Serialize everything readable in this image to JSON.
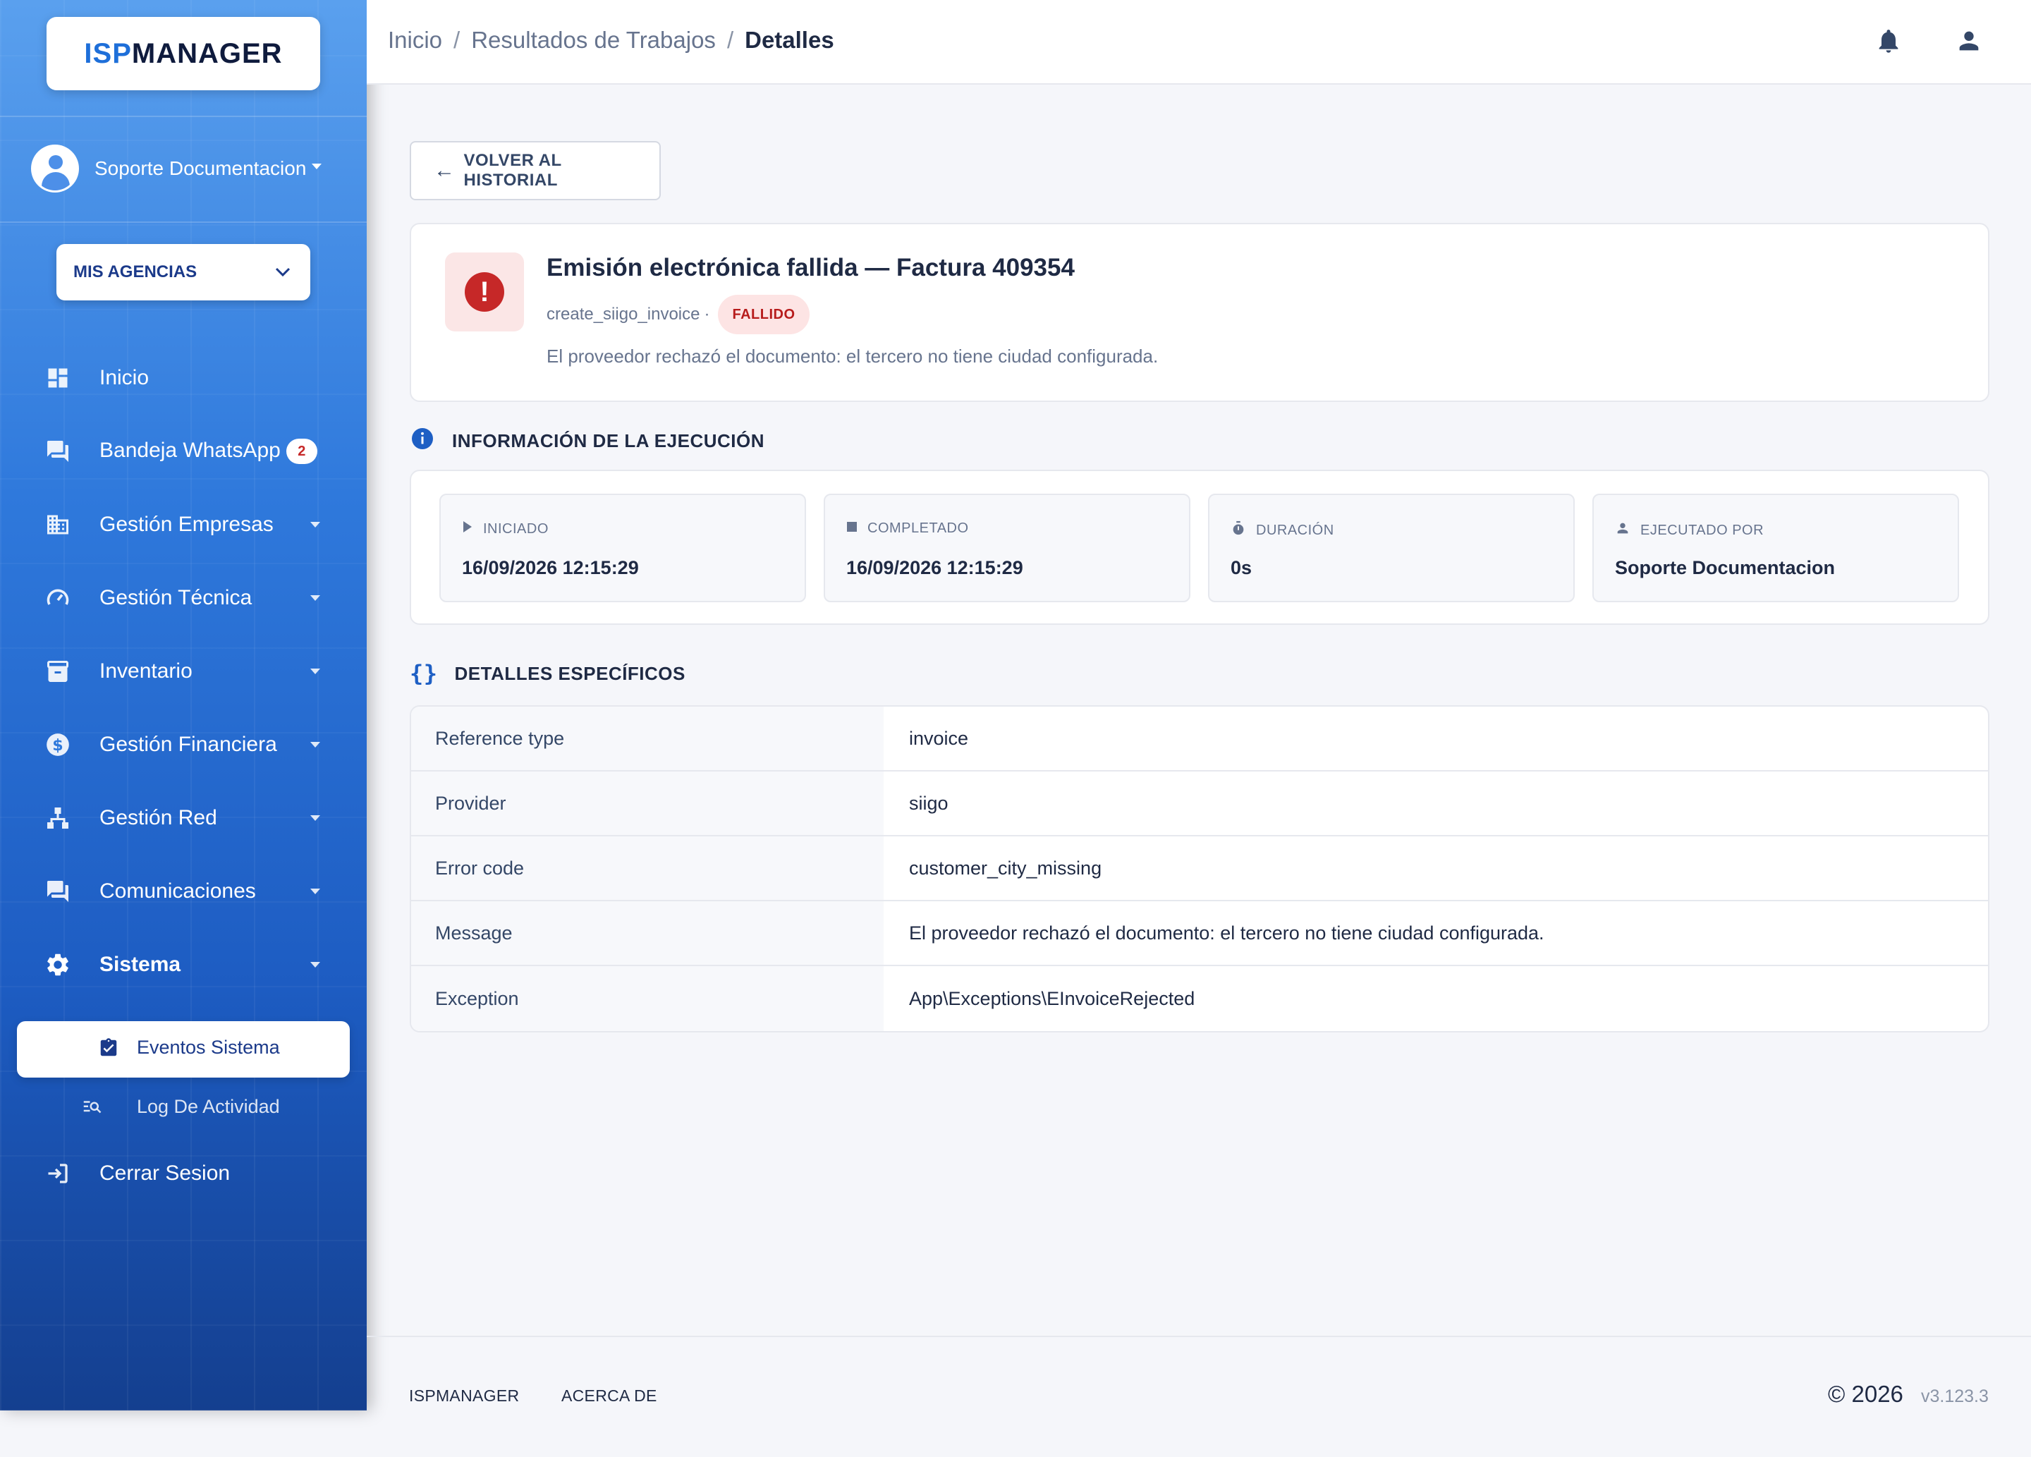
{
  "sidebar": {
    "logo": {
      "part1": "ISP",
      "part2": "MANAGER"
    },
    "user": {
      "name": "Soporte Documentacion"
    },
    "agency_button": "MIS AGENCIAS",
    "items": [
      {
        "label": "Inicio",
        "icon": "dashboard-icon"
      },
      {
        "label": "Bandeja WhatsApp",
        "icon": "chat-icon",
        "badge": "2"
      },
      {
        "label": "Gestión Empresas",
        "icon": "building-icon"
      },
      {
        "label": "Gestión Técnica",
        "icon": "gauge-icon"
      },
      {
        "label": "Inventario",
        "icon": "archive-icon"
      },
      {
        "label": "Gestión Financiera",
        "icon": "dollar-icon"
      },
      {
        "label": "Gestión Red",
        "icon": "network-icon"
      },
      {
        "label": "Comunicaciones",
        "icon": "forum-icon"
      },
      {
        "label": "Sistema",
        "icon": "gear-icon"
      }
    ],
    "subitems": [
      {
        "label": "Eventos Sistema",
        "icon": "clipboard-check-icon"
      },
      {
        "label": "Log De Actividad",
        "icon": "search-list-icon"
      }
    ],
    "logout": "Cerrar Sesion"
  },
  "header": {
    "breadcrumb": [
      "Inicio",
      "Resultados de Trabajos",
      "Detalles"
    ]
  },
  "main": {
    "back_button": "VOLVER AL HISTORIAL",
    "error": {
      "title": "Emisión electrónica fallida — Factura 409354",
      "job": "create_siigo_invoice",
      "separator": "·",
      "status": "FALLIDO",
      "message": "El proveedor rechazó el documento: el tercero no tiene ciudad configurada."
    },
    "execution": {
      "title": "INFORMACIÓN DE LA EJECUCIÓN",
      "boxes": [
        {
          "label": "INICIADO",
          "value": "16/09/2026 12:15:29",
          "icon": "play-icon"
        },
        {
          "label": "COMPLETADO",
          "value": "16/09/2026 12:15:29",
          "icon": "stop-icon"
        },
        {
          "label": "DURACIÓN",
          "value": "0s",
          "icon": "timer-icon"
        },
        {
          "label": "EJECUTADO POR",
          "value": "Soporte Documentacion",
          "icon": "person-icon"
        }
      ]
    },
    "details": {
      "title": "DETALLES ESPECÍFICOS",
      "rows": [
        {
          "key": "Reference type",
          "value": "invoice"
        },
        {
          "key": "Provider",
          "value": "siigo"
        },
        {
          "key": "Error code",
          "value": "customer_city_missing"
        },
        {
          "key": "Message",
          "value": "El proveedor rechazó el documento: el tercero no tiene ciudad configurada."
        },
        {
          "key": "Exception",
          "value": "App\\Exceptions\\EInvoiceRejected"
        }
      ]
    }
  },
  "footer": {
    "links": [
      "ISPMANAGER",
      "ACERCA DE"
    ],
    "copyright": "© 2026",
    "version": "v3.123.3"
  },
  "colors": {
    "sidebar_top": "#5aa0ee",
    "sidebar_bottom": "#143f8f",
    "accent": "#1e6fd9",
    "error": "#c62828",
    "error_bg": "#fbe6e6"
  }
}
